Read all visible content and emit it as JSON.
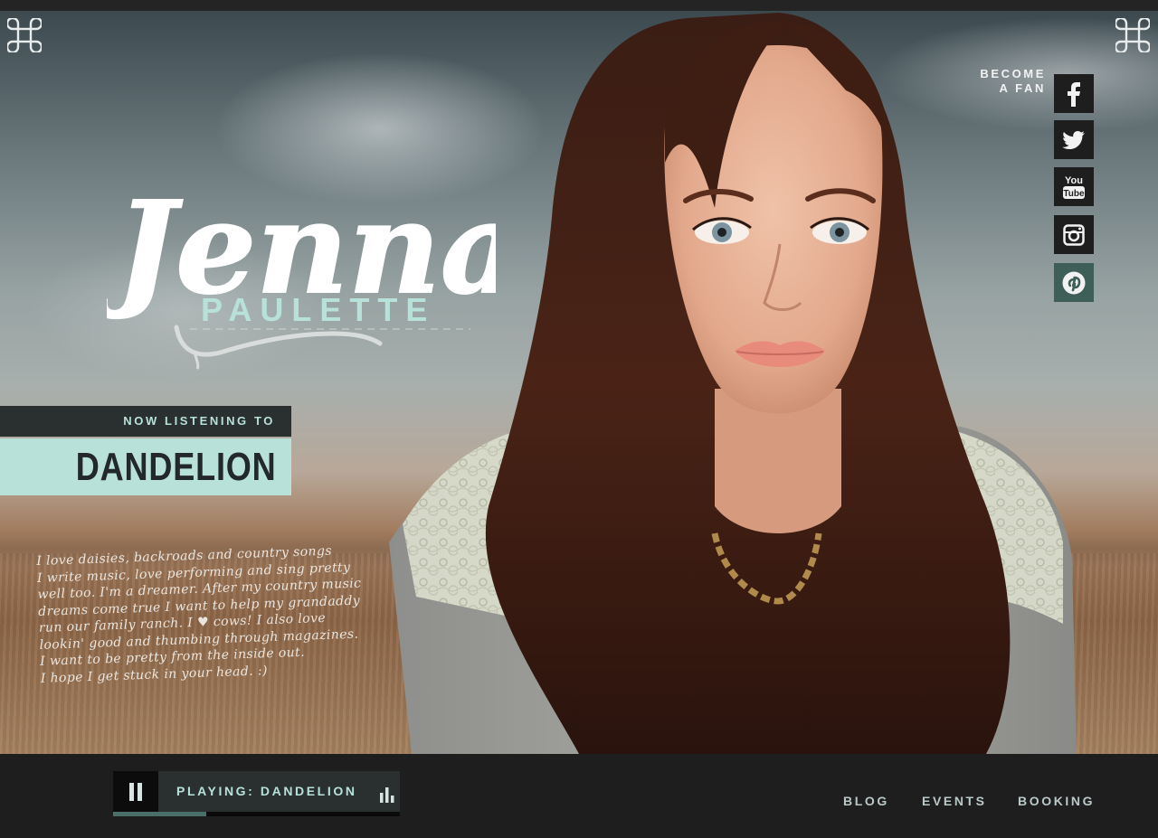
{
  "header": {
    "logo": {
      "first_name": "Jenna",
      "last_name": "PAULETTE"
    },
    "corner_icons": [
      "command-icon",
      "command-icon"
    ]
  },
  "social": {
    "label_line1": "BECOME",
    "label_line2": "A FAN",
    "links": [
      {
        "name": "facebook",
        "icon": "facebook-icon"
      },
      {
        "name": "twitter",
        "icon": "twitter-icon"
      },
      {
        "name": "youtube",
        "icon": "youtube-icon",
        "icon_text": "You Tube"
      },
      {
        "name": "instagram",
        "icon": "instagram-icon"
      },
      {
        "name": "pinterest",
        "icon": "pinterest-icon"
      }
    ]
  },
  "now_listening": {
    "label": "NOW LISTENING TO",
    "song": "DANDELION"
  },
  "bio": {
    "lines": [
      "I love daisies, backroads and country songs",
      "I write music, love performing and sing pretty",
      "well too. I'm a dreamer. After my country music",
      "dreams come true I want to help my grandaddy",
      "run our family ranch. I ♥ cows! I also love",
      "lookin' good and thumbing through magazines.",
      "I want to be pretty from the inside out.",
      "I hope I get stuck in your head. :)"
    ]
  },
  "player": {
    "prefix": "PLAYING:",
    "track": "DANDELION",
    "progress": 0.325,
    "pause_icon": "pause-icon",
    "bars_icon": "equalizer-icon"
  },
  "nav": {
    "blog": "BLOG",
    "events": "EVENTS",
    "booking": "BOOKING"
  },
  "colors": {
    "accent": "#b7e1d9",
    "dark": "#1e1e1e",
    "panel": "#2a2f2f",
    "pinterest_bg": "#3d5f58"
  }
}
